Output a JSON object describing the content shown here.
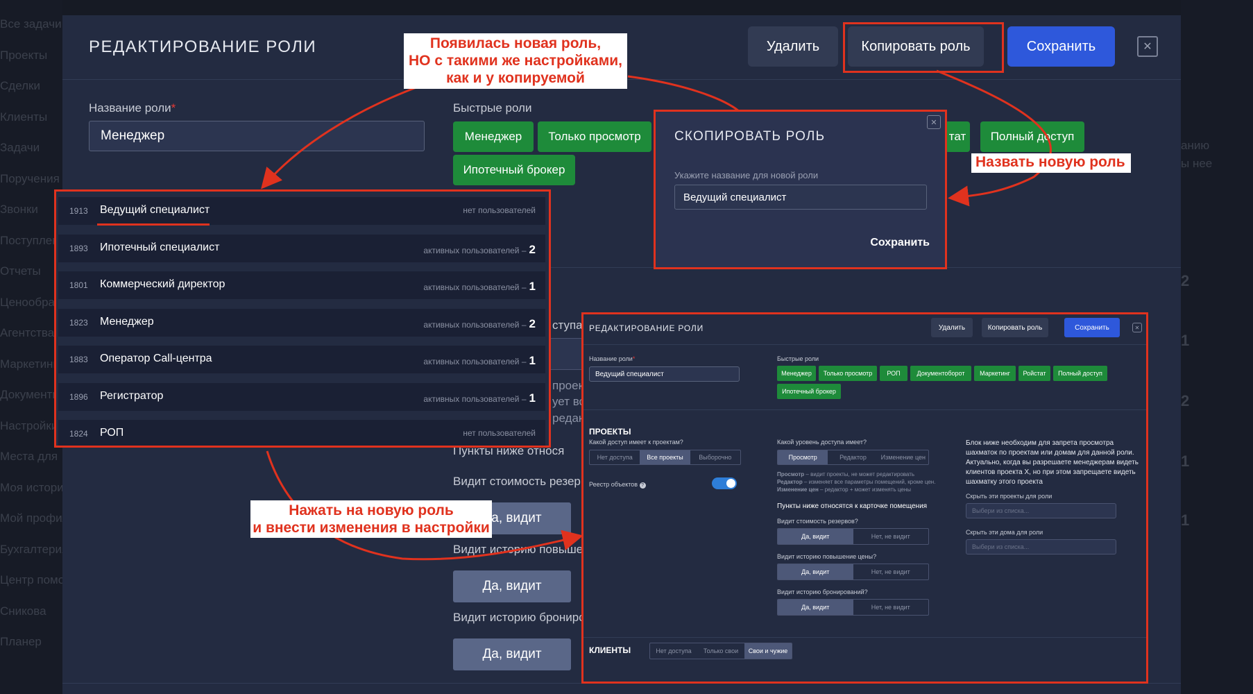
{
  "background": {
    "sidebar_items": [
      "Все задачи",
      "Проекты",
      "Сделки",
      "Клиенты",
      "Задачи",
      "Поручения",
      "Звонки",
      "Поступления",
      "Отчеты",
      "Ценообразование",
      "Агентства",
      "Маркетинг",
      "Документы",
      "Настройки",
      "Места для",
      "Моя история",
      "Мой профиль",
      "Бухгалтерия",
      "Центр помощи",
      "Сникова",
      "Планер"
    ],
    "right_text_1": "анию",
    "right_text_2": "ы нее",
    "right_nums": [
      "2",
      "1",
      "2",
      "1",
      "1"
    ]
  },
  "modal": {
    "title": "РЕДАКТИРОВАНИЕ РОЛИ",
    "delete_label": "Удалить",
    "copy_label": "Копировать роль",
    "save_label": "Сохранить",
    "close_glyph": "✕",
    "role_name_label": "Название роли",
    "required_mark": "*",
    "role_name_value": "Менеджер",
    "quick_roles_label": "Быстрые роли",
    "chips": [
      "Менеджер",
      "Только просмотр",
      "тат",
      "Полный доступ",
      "Ипотечный брокер"
    ],
    "partial_text": {
      "dostupa": "ступа к",
      "proek": "проек",
      "vet": "ует вс",
      "redak": "редак",
      "punkty": "Пункты ниже относя"
    },
    "sees_cost": "Видит стоимость резерв",
    "sees_price_history": "Видит историю повышен",
    "sees_booking_history": "Видит историю бронирс",
    "yes_sees": "Да, видит"
  },
  "role_list": [
    {
      "id": "1913",
      "name": "Ведущий специалист",
      "users_text": "нет пользователей",
      "count": ""
    },
    {
      "id": "1893",
      "name": "Ипотечный специалист",
      "users_text": "активных пользователей –",
      "count": "2"
    },
    {
      "id": "1801",
      "name": "Коммерческий директор",
      "users_text": "активных пользователей –",
      "count": "1"
    },
    {
      "id": "1823",
      "name": "Менеджер",
      "users_text": "активных пользователей –",
      "count": "2"
    },
    {
      "id": "1883",
      "name": "Оператор Call-центра",
      "users_text": "активных пользователей –",
      "count": "1"
    },
    {
      "id": "1896",
      "name": "Регистратор",
      "users_text": "активных пользователей –",
      "count": "1"
    },
    {
      "id": "1824",
      "name": "РОП",
      "users_text": "нет пользователей",
      "count": ""
    }
  ],
  "copy_dialog": {
    "title": "СКОПИРОВАТЬ РОЛЬ",
    "field_label": "Укажите название для новой роли",
    "field_value": "Ведущий специалист",
    "save_label": "Сохранить",
    "close_glyph": "✕"
  },
  "callouts": {
    "new_role_1": "Появилась новая роль,",
    "new_role_2": "НО с такими же настройками,",
    "new_role_3": "как и у копируемой",
    "name_new": "Назвать новую роль",
    "click_new_1": "Нажать на новую роль",
    "click_new_2": "и внести изменения в настройки"
  },
  "mini": {
    "title": "РЕДАКТИРОВАНИЕ РОЛИ",
    "delete_label": "Удалить",
    "copy_label": "Копировать роль",
    "save_label": "Сохранить",
    "close_glyph": "✕",
    "role_name_label": "Название роли",
    "role_name_value": "Ведущий специалист",
    "quick_roles_label": "Быстрые роли",
    "chips": [
      "Менеджер",
      "Только просмотр",
      "РОП",
      "Документоборот",
      "Маркетинг",
      "Ройстат",
      "Полный доступ",
      "Ипотечный брокер"
    ],
    "projects_head": "ПРОЕКТЫ",
    "projects_q": "Какой доступ имеет к проектам?",
    "projects_seg": [
      "Нет доступа",
      "Все проекты",
      "Выборочно"
    ],
    "registry": "Реестр объектов",
    "help_glyph": "?",
    "level_q": "Какой уровень доступа имеет?",
    "level_seg": [
      "Просмотр",
      "Редактор",
      "Изменение цен"
    ],
    "desc_1_bold": "Просмотр",
    "desc_1": " – видит проекты, не может редактировать",
    "desc_2_bold": "Редактор",
    "desc_2": " – изменяет все параметры помещений, кроме цен.",
    "desc_3_bold": "Изменение цен",
    "desc_3": " – редактор + может изменять цены",
    "card_head": "Пункты ниже относятся к карточке помещения",
    "q_cost": "Видит стоимость резервов?",
    "q_price": "Видит историю повышение цены?",
    "q_booking": "Видит историю бронирований?",
    "yes": "Да, видит",
    "no": "Нет, не видит",
    "info_1": "Блок ниже необходим для запрета просмотра",
    "info_2": "шахматок по проектам или домам для данной роли.",
    "info_3": "Актуально, когда вы разрешаете менеджерам видеть",
    "info_4": "клиентов проекта X, но при этом запрещаете видеть",
    "info_5": "шахматку этого проекта",
    "hide_projects": "Скрыть эти проекты для роли",
    "hide_houses": "Скрыть эти дома для роли",
    "select_placeholder": "Выбери из списка...",
    "clients_head": "КЛИЕНТЫ",
    "clients_seg": [
      "Нет доступа",
      "Только свои",
      "Свои и чужие"
    ]
  },
  "colors": {
    "accent_red": "#e0321e",
    "green": "#1e8b3a",
    "blue": "#2e58db",
    "panel": "#232b41"
  }
}
